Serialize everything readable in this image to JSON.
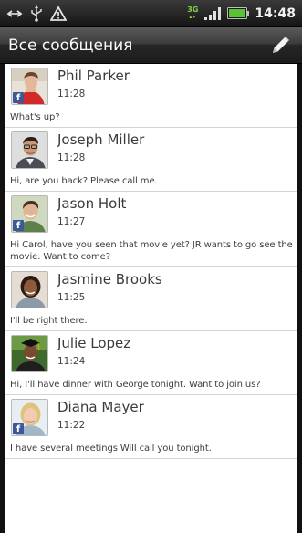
{
  "status_bar": {
    "network_type": "3G",
    "time": "14:48",
    "icons": [
      "usb-sync-icon",
      "usb-icon",
      "warning-icon",
      "signal-icon",
      "battery-icon"
    ]
  },
  "header": {
    "title": "Все сообщения",
    "compose_icon": "pencil-icon"
  },
  "colors": {
    "facebook_badge": "#3b5998",
    "list_background": "#ffffff",
    "header_background": "#2a2a2a"
  },
  "messages": [
    {
      "sender": "Phil Parker",
      "time": "11:28",
      "preview": "What's up?",
      "facebook": "f"
    },
    {
      "sender": "Joseph Miller",
      "time": "11:28",
      "preview": "Hi, are you back? Please call me."
    },
    {
      "sender": "Jason Holt",
      "time": "11:27",
      "preview": "Hi Carol, have you seen that movie yet? JR wants to go see the movie. Want to come?",
      "facebook": "f"
    },
    {
      "sender": "Jasmine Brooks",
      "time": "11:25",
      "preview": "I'll be right there."
    },
    {
      "sender": "Julie Lopez",
      "time": "11:24",
      "preview": "Hi, I'll have dinner with George tonight. Want to join us?"
    },
    {
      "sender": "Diana Mayer",
      "time": "11:22",
      "preview": "I have several meetings  Will call you tonight.",
      "facebook": "f"
    }
  ]
}
